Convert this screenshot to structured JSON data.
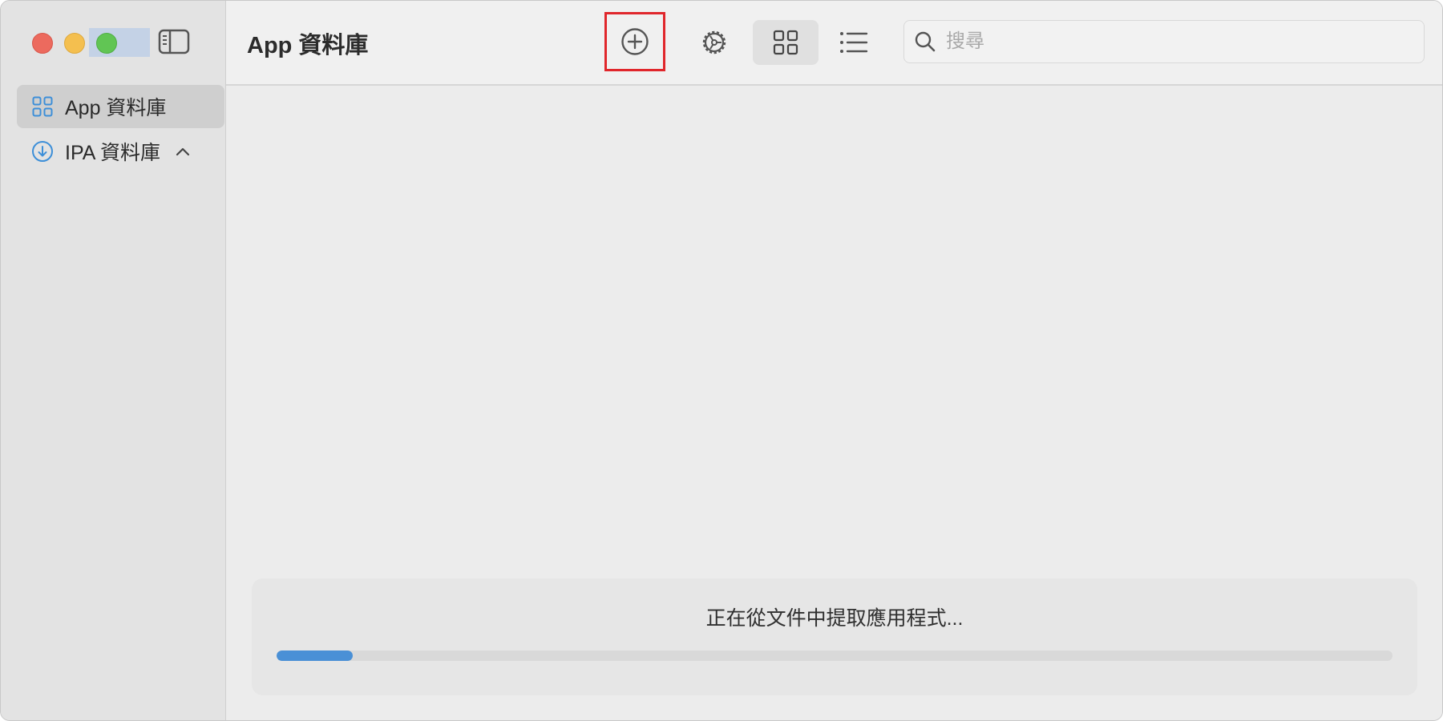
{
  "window": {
    "title": "App 資料庫"
  },
  "sidebar": {
    "items": [
      {
        "label": "App 資料庫",
        "icon": "grid-icon",
        "selected": true
      },
      {
        "label": "IPA 資料庫",
        "icon": "download-circle-icon",
        "expanded": true
      }
    ]
  },
  "toolbar": {
    "title": "App 資料庫",
    "buttons": [
      {
        "name": "add-button",
        "icon": "plus-circle-icon"
      },
      {
        "name": "settings-button",
        "icon": "gear-icon"
      },
      {
        "name": "grid-view-button",
        "icon": "grid-icon",
        "active": true
      },
      {
        "name": "list-view-button",
        "icon": "list-icon"
      }
    ],
    "search": {
      "placeholder": "搜尋",
      "value": ""
    }
  },
  "progress": {
    "message": "正在從文件中提取應用程式...",
    "value": 0.068
  },
  "colors": {
    "accent": "#4a90d6",
    "highlight_border": "#e0262b",
    "traffic_red": "#ec6a5e",
    "traffic_yellow": "#f4bf4f",
    "traffic_green": "#61c554"
  }
}
